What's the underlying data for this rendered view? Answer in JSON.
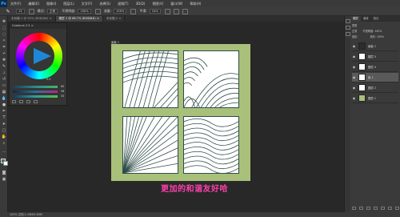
{
  "menu": {
    "logo": "Ps",
    "items": [
      "文件(F)",
      "编辑(E)",
      "图像(I)",
      "图层(L)",
      "文字(Y)",
      "选择(S)",
      "滤镜(T)",
      "3D(D)",
      "视图(V)",
      "窗口(W)",
      "帮助(H)"
    ]
  },
  "options": {
    "tool_icon": "brush-icon",
    "brush_size": "13",
    "mode_label": "模式:",
    "mode_value": "正常",
    "opacity_label": "不透明度:",
    "opacity_value": "100%",
    "flow_label": "流量:",
    "flow_value": "100%",
    "smooth_label": "平滑:",
    "smooth_value": "10%"
  },
  "tabs": [
    {
      "label": "未标题-1 @ 50% (RGB/8#) ×",
      "active": false
    },
    {
      "label": "图层 1 @ 66.7% (RGB/8#) ×",
      "active": true
    },
    {
      "label": "未标题-2 ×",
      "active": false
    }
  ],
  "color_panel": {
    "title": "Coolorus 2.5 ×",
    "value_readout": "0.0",
    "sliders": [
      {
        "value": "80"
      },
      {
        "value": "58"
      },
      {
        "value": "53"
      }
    ]
  },
  "document": {
    "label": "画板 1"
  },
  "caption": "更加的和谐友好哈",
  "status": "100% 文档:1.16M/9.80M",
  "layers_panel": {
    "tabs": [
      "图层",
      "通道",
      "路径"
    ],
    "kind_label": "类型",
    "mode_value": "正常",
    "opacity_label": "不透明度:",
    "opacity_value": "100%",
    "lock_label": "锁定:",
    "fill_label": "填充:",
    "fill_value": "100%",
    "layers": [
      {
        "name": "画板 1",
        "thumb": "#2d2d2d",
        "active": false
      },
      {
        "name": "图层 5",
        "thumb": "#ffffff",
        "active": false
      },
      {
        "name": "图层 4",
        "thumb": "#ffffff",
        "active": false
      },
      {
        "name": "组 1",
        "thumb": "#ffffff",
        "active": true
      },
      {
        "name": "图层 2",
        "thumb": "#ffffff",
        "active": false
      },
      {
        "name": "图层 1",
        "thumb": "#a8c07a",
        "active": false
      }
    ]
  },
  "colors": {
    "artboard_bg": "#a8c07a",
    "line_color": "#2f4d4a",
    "caption_color": "#ff3fae",
    "foreground": "#4a6a6a",
    "background": "#ffffff"
  }
}
